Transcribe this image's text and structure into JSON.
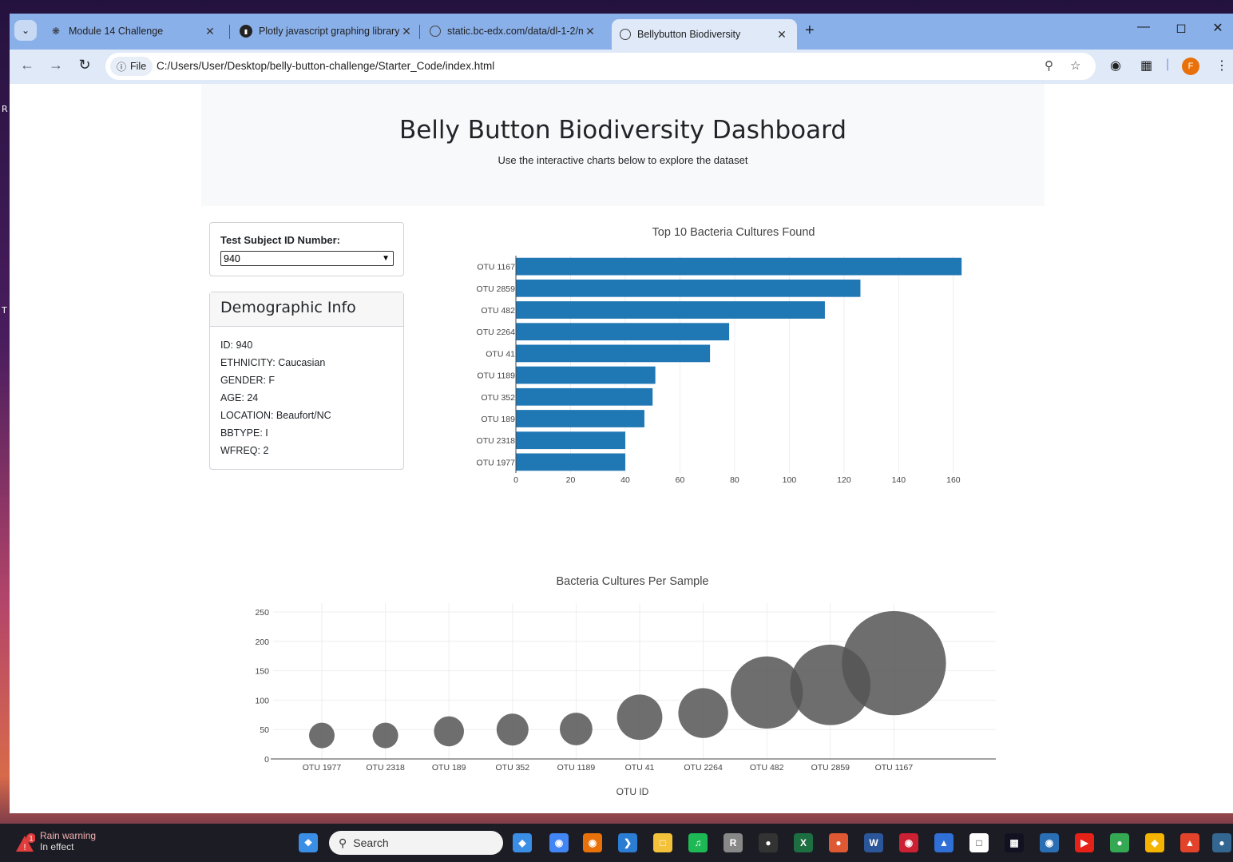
{
  "browser": {
    "tabs": [
      {
        "title": "Module 14 Challenge",
        "active": false,
        "icon": "tree-icon"
      },
      {
        "title": "Plotly javascript graphing library",
        "active": false,
        "icon": "plotly-icon"
      },
      {
        "title": "static.bc-edx.com/data/dl-1-2/m",
        "active": false,
        "icon": "globe-icon"
      },
      {
        "title": "Bellybutton Biodiversity",
        "active": true,
        "icon": "globe-icon"
      }
    ],
    "site_chip": "File",
    "url": "C:/Users/User/Desktop/belly-button-challenge/Starter_Code/index.html",
    "profile_initial": "F"
  },
  "page": {
    "title": "Belly Button Biodiversity Dashboard",
    "subtitle": "Use the interactive charts below to explore the dataset",
    "select_label": "Test Subject ID Number:",
    "selected_id": "940",
    "demo_title": "Demographic Info",
    "demographics": [
      "ID: 940",
      "ETHNICITY: Caucasian",
      "GENDER: F",
      "AGE: 24",
      "LOCATION: Beaufort/NC",
      "BBTYPE: I",
      "WFREQ: 2"
    ]
  },
  "chart_data": [
    {
      "type": "bar",
      "orientation": "horizontal",
      "title": "Top 10 Bacteria Cultures Found",
      "categories": [
        "OTU 1167",
        "OTU 2859",
        "OTU 482",
        "OTU 2264",
        "OTU 41",
        "OTU 1189",
        "OTU 352",
        "OTU 189",
        "OTU 2318",
        "OTU 1977"
      ],
      "values": [
        163,
        126,
        113,
        78,
        71,
        51,
        50,
        47,
        40,
        40
      ],
      "xlim": [
        0,
        165
      ],
      "xticks": [
        0,
        20,
        40,
        60,
        80,
        100,
        120,
        140,
        160
      ],
      "color": "#1f77b4",
      "grid": true
    },
    {
      "type": "scatter",
      "subtype": "bubble",
      "title": "Bacteria Cultures Per Sample",
      "xlabel": "OTU ID",
      "categories": [
        "OTU 1977",
        "OTU 2318",
        "OTU 189",
        "OTU 352",
        "OTU 1189",
        "OTU 41",
        "OTU 2264",
        "OTU 482",
        "OTU 2859",
        "OTU 1167"
      ],
      "values": [
        40,
        40,
        47,
        50,
        51,
        71,
        78,
        113,
        126,
        163
      ],
      "ylim": [
        0,
        265
      ],
      "yticks": [
        0,
        50,
        100,
        150,
        200,
        250
      ],
      "color": "#555555",
      "grid": true
    }
  ],
  "taskbar": {
    "weather_title": "Rain warning",
    "weather_sub": "In effect",
    "weather_badge": "1",
    "search_placeholder": "Search"
  }
}
